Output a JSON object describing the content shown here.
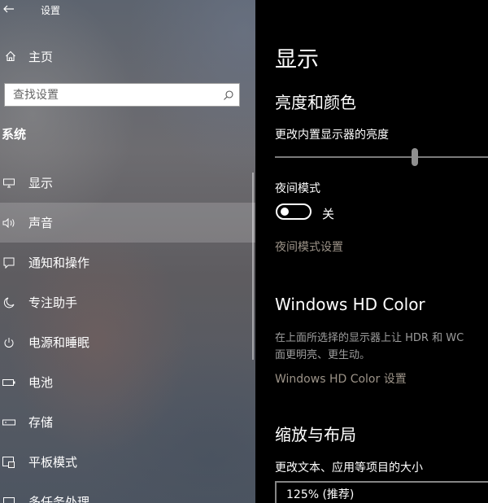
{
  "window": {
    "title": "设置"
  },
  "sidebar": {
    "home_label": "主页",
    "search": {
      "placeholder": "查找设置",
      "value": ""
    },
    "section_title": "系统",
    "items": [
      {
        "label": "显示",
        "icon": "monitor-icon"
      },
      {
        "label": "声音",
        "icon": "speaker-icon",
        "selected": true
      },
      {
        "label": "通知和操作",
        "icon": "notification-icon"
      },
      {
        "label": "专注助手",
        "icon": "moon-icon"
      },
      {
        "label": "电源和睡眠",
        "icon": "power-icon"
      },
      {
        "label": "电池",
        "icon": "battery-icon"
      },
      {
        "label": "存储",
        "icon": "storage-icon"
      },
      {
        "label": "平板模式",
        "icon": "tablet-icon"
      },
      {
        "label": "多任务处理",
        "icon": "multitask-icon"
      }
    ]
  },
  "main": {
    "page_title": "显示",
    "brightness_heading": "亮度和颜色",
    "brightness_label": "更改内置显示器的亮度",
    "brightness_level": 0.6,
    "night_mode_label": "夜间模式",
    "night_mode_state": "关",
    "night_mode_on": false,
    "night_mode_link": "夜间模式设置",
    "hd_heading": "Windows HD Color",
    "hd_desc_line1": "在上面所选择的显示器上让 HDR 和 WC",
    "hd_desc_line2": "面更明亮、更生动。",
    "hd_link": "Windows HD Color 设置",
    "scale_heading": "缩放与布局",
    "scale_label": "更改文本、应用等项目的大小",
    "scale_value": "125% (推荐)"
  },
  "colors": {
    "main_bg": "#000000",
    "link": "#9c9388",
    "secondary_text": "#9d9d9d"
  }
}
